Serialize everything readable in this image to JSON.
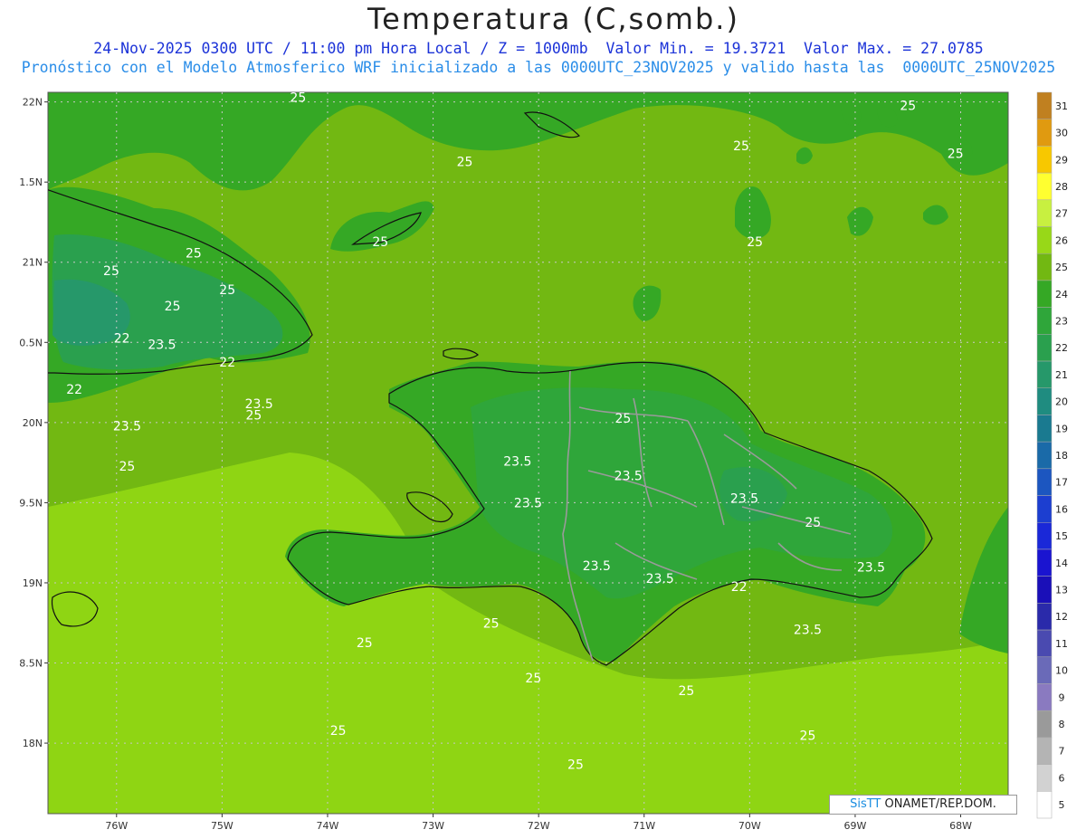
{
  "header": {
    "title": "Temperatura (C,somb.)",
    "line1": "24-Nov-2025 0300 UTC / 11:00 pm Hora Local / Z = 1000mb  Valor Min. = 19.3721  Valor Max. = 27.0785",
    "line2": "Pronóstico con el Modelo Atmosferico WRF inicializado a las 0000UTC_23NOV2025 y valido hasta las  0000UTC_25NOV2025"
  },
  "credit": {
    "brand": "SisTT",
    "org": " ONAMET/REP.DOM."
  },
  "chart_data": {
    "type": "heatmap",
    "title": "Temperatura (C,somb.)",
    "xlim": [
      -76.65,
      -67.55
    ],
    "ylim": [
      17.56,
      22.06
    ],
    "x_ticks": [
      {
        "value": -76,
        "label": "76W"
      },
      {
        "value": -75,
        "label": "75W"
      },
      {
        "value": -74,
        "label": "74W"
      },
      {
        "value": -73,
        "label": "73W"
      },
      {
        "value": -72,
        "label": "72W"
      },
      {
        "value": -71,
        "label": "71W"
      },
      {
        "value": -70,
        "label": "70W"
      },
      {
        "value": -69,
        "label": "69W"
      },
      {
        "value": -68,
        "label": "68W"
      }
    ],
    "y_ticks": [
      {
        "value": 22,
        "label": "22N"
      },
      {
        "value": 21.5,
        "label": "1.5N"
      },
      {
        "value": 21,
        "label": "21N"
      },
      {
        "value": 20.5,
        "label": "0.5N"
      },
      {
        "value": 20,
        "label": "20N"
      },
      {
        "value": 19.5,
        "label": "9.5N"
      },
      {
        "value": 19,
        "label": "19N"
      },
      {
        "value": 18.5,
        "label": "8.5N"
      },
      {
        "value": 18,
        "label": "18N"
      },
      {
        "value": 17.5,
        "label": "7.5N"
      },
      {
        "value": 17,
        "label": "17N"
      },
      {
        "value": 16.5,
        "label": "6.5N"
      }
    ],
    "grid": true,
    "colorbar": {
      "placement": "right",
      "levels": [
        "31",
        "30",
        "29",
        "28",
        "27",
        "26",
        "25",
        "24",
        "23",
        "22",
        "21",
        "20",
        "19",
        "18",
        "17",
        "16",
        "15",
        "14",
        "13",
        "12",
        "11",
        "10",
        "9",
        "8",
        "7",
        "6",
        "5"
      ],
      "colors": [
        "#c08020",
        "#e09a10",
        "#f7c800",
        "#ffff30",
        "#c8f040",
        "#98d818",
        "#72b812",
        "#35a825",
        "#2fa63a",
        "#2aa04e",
        "#26986a",
        "#1f8c80",
        "#1a7a90",
        "#1a6aa8",
        "#1c56c0",
        "#1c3ed0",
        "#1a28d8",
        "#1a14d0",
        "#1a0fb8",
        "#2a2aaa",
        "#4a4ab0",
        "#6a6ab8",
        "#8a7ac0",
        "#9a9a9a",
        "#b4b4b4",
        "#d2d2d2",
        "#ffffff"
      ]
    },
    "contour_labels": [
      {
        "text": "25",
        "lon": -75.27,
        "lat": 21.03
      },
      {
        "text": "25",
        "lon": -74.28,
        "lat": 22.0
      },
      {
        "text": "25",
        "lon": -73.5,
        "lat": 21.1
      },
      {
        "text": "25",
        "lon": -72.7,
        "lat": 21.6
      },
      {
        "text": "25",
        "lon": -70.08,
        "lat": 21.7
      },
      {
        "text": "25",
        "lon": -68.5,
        "lat": 21.95
      },
      {
        "text": "25",
        "lon": -68.05,
        "lat": 21.65
      },
      {
        "text": "25",
        "lon": -69.95,
        "lat": 21.1
      },
      {
        "text": "25",
        "lon": -76.05,
        "lat": 20.92
      },
      {
        "text": "25",
        "lon": -75.47,
        "lat": 20.7
      },
      {
        "text": "25",
        "lon": -74.95,
        "lat": 20.8
      },
      {
        "text": "25",
        "lon": -74.7,
        "lat": 20.02
      },
      {
        "text": "25",
        "lon": -75.9,
        "lat": 19.7
      },
      {
        "text": "25",
        "lon": -71.2,
        "lat": 20.0
      },
      {
        "text": "25",
        "lon": -69.4,
        "lat": 19.35
      },
      {
        "text": "25",
        "lon": -72.45,
        "lat": 18.72
      },
      {
        "text": "25",
        "lon": -73.65,
        "lat": 18.6
      },
      {
        "text": "25",
        "lon": -73.9,
        "lat": 18.05
      },
      {
        "text": "25",
        "lon": -72.05,
        "lat": 18.38
      },
      {
        "text": "25",
        "lon": -70.6,
        "lat": 18.3
      },
      {
        "text": "25",
        "lon": -69.45,
        "lat": 18.02
      },
      {
        "text": "25",
        "lon": -71.65,
        "lat": 17.84
      },
      {
        "text": "22",
        "lon": -75.95,
        "lat": 20.5
      },
      {
        "text": "22",
        "lon": -74.95,
        "lat": 20.35
      },
      {
        "text": "22",
        "lon": -76.4,
        "lat": 20.18
      },
      {
        "text": "22",
        "lon": -70.1,
        "lat": 18.95
      },
      {
        "text": "23.5",
        "lon": -75.57,
        "lat": 20.46
      },
      {
        "text": "23.5",
        "lon": -74.65,
        "lat": 20.09
      },
      {
        "text": "23.5",
        "lon": -75.9,
        "lat": 19.95
      },
      {
        "text": "23.5",
        "lon": -72.2,
        "lat": 19.73
      },
      {
        "text": "23.5",
        "lon": -71.15,
        "lat": 19.64
      },
      {
        "text": "23.5",
        "lon": -72.1,
        "lat": 19.47
      },
      {
        "text": "23.5",
        "lon": -70.05,
        "lat": 19.5
      },
      {
        "text": "23.5",
        "lon": -71.45,
        "lat": 19.08
      },
      {
        "text": "23.5",
        "lon": -70.85,
        "lat": 19.0
      },
      {
        "text": "23.5",
        "lon": -68.85,
        "lat": 19.07
      },
      {
        "text": "23.5",
        "lon": -69.45,
        "lat": 18.68
      }
    ]
  }
}
